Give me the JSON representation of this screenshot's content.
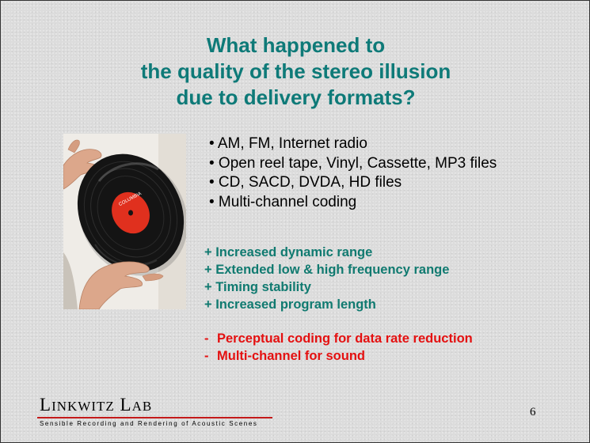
{
  "title": {
    "lines": [
      "What happened to",
      "the quality of the stereo illusion",
      "due to delivery formats?"
    ]
  },
  "photo": {
    "label_text": "COLUMBIA"
  },
  "bullets": [
    "• AM, FM, Internet radio",
    "• Open reel tape, Vinyl, Cassette, MP3 files",
    "• CD, SACD, DVDA, HD files",
    "• Multi-channel coding"
  ],
  "advantages": [
    "+ Increased dynamic range",
    "+ Extended low & high frequency range",
    "+ Timing stability",
    "+ Increased program length"
  ],
  "disadvantages": [
    {
      "dash": "-",
      "text": "Perceptual coding for data rate reduction"
    },
    {
      "dash": "-",
      "text": "Multi-channel for sound"
    }
  ],
  "footer": {
    "logo_first_initial": "L",
    "logo_first_rest": "INKWITZ",
    "logo_second_initial": "L",
    "logo_second_rest": "AB",
    "tagline": "Sensible Recording and Rendering of Acoustic Scenes",
    "page_number": "6"
  },
  "colors": {
    "title": "#0e7a78",
    "advantages": "#107a70",
    "disadvantages": "#e41010",
    "logo_rule": "#c41a1a",
    "record_label": "#e0301e"
  }
}
